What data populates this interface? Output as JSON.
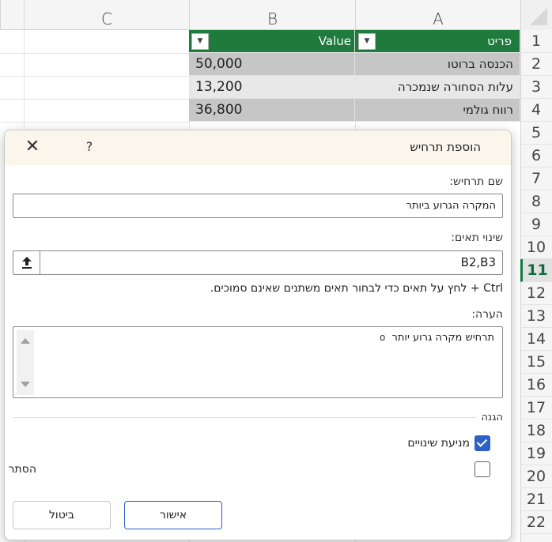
{
  "sheet": {
    "columns": [
      "A",
      "B",
      "C"
    ],
    "rows": [
      "1",
      "2",
      "3",
      "4",
      "5",
      "6",
      "7",
      "8",
      "9",
      "10",
      "11",
      "12",
      "13",
      "14",
      "15",
      "16",
      "17",
      "18",
      "19",
      "20",
      "21",
      "22"
    ],
    "selected_row": "11",
    "table_headers": {
      "item": "פריט",
      "value": "Value"
    },
    "table_rows": [
      {
        "item": "הכנסה ברוטו",
        "value": "50,000"
      },
      {
        "item": "עלות הסחורה שנמכרה",
        "value": "13,200"
      },
      {
        "item": "רווח גולמי",
        "value": "36,800"
      }
    ],
    "colors": {
      "header_green": "#1f7a3d",
      "cell_gray": "#c6c6c6"
    }
  },
  "dialog": {
    "title": "הוספת תרחיש",
    "help_glyph": "?",
    "close_glyph": "✕",
    "scenario_name_label": "שם תרחיש:",
    "scenario_name_value": "המקרה הגרוע ביותר",
    "changing_cells_label": "שינוי תאים:",
    "changing_cells_value": "B2,B3",
    "hint": "Ctrl + לחץ על תאים כדי לבחור תאים משתנים שאינם סמוכים.",
    "comment_label": "הערה:",
    "comment_value": "תרחיש מקרה גרוע יותר",
    "protection_label": "הגנה",
    "prevent_changes_label": "מניעת שינויים",
    "prevent_changes_checked": true,
    "hide_label": "הסתר",
    "hide_checked": false,
    "ok_label": "אישור",
    "cancel_label": "ביטול",
    "accent": "#2c62c7"
  }
}
